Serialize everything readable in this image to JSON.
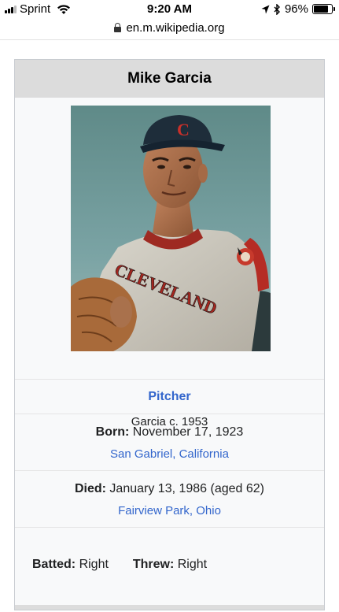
{
  "status_bar": {
    "carrier": "Sprint",
    "time": "9:20 AM",
    "battery_percent": "96%",
    "battery_level": 0.96
  },
  "browser": {
    "url": "en.m.wikipedia.org"
  },
  "infobox": {
    "title": "Mike Garcia",
    "caption": "Garcia c. 1953",
    "position": "Pitcher",
    "born_label": "Born:",
    "born_date": "November 17, 1923",
    "born_place": "San Gabriel, California",
    "died_label": "Died:",
    "died_date": "January 13, 1986 (aged 62)",
    "died_place": "Fairview Park, Ohio",
    "batted_label": "Batted:",
    "batted_value": "Right",
    "threw_label": "Threw:",
    "threw_value": "Right",
    "cap_logo": "C",
    "jersey_text": "CLEVELAND"
  },
  "colors": {
    "link": "#3366cc",
    "header_bg": "#dcdcdc",
    "infobox_bg": "#f8f9fa"
  }
}
